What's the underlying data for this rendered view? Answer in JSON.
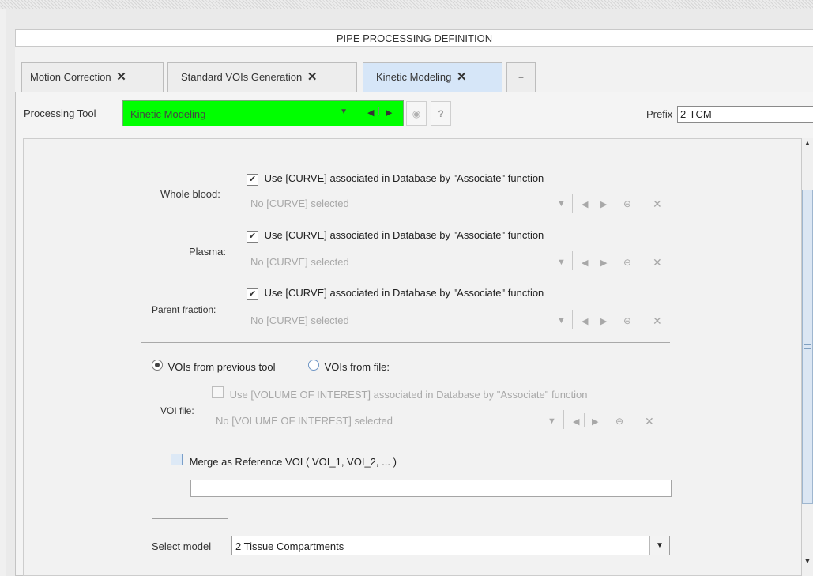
{
  "title": "PIPE PROCESSING DEFINITION",
  "tabs": [
    {
      "label": "Motion Correction",
      "close": "✕"
    },
    {
      "label": "Standard VOIs Generation",
      "close": "✕"
    },
    {
      "label": "Kinetic Modeling",
      "close": "✕"
    },
    {
      "label": "+"
    }
  ],
  "toolbar": {
    "processing_tool_label": "Processing Tool",
    "tool_value": "Kinetic Modeling",
    "help": "?",
    "prefix_label": "Prefix",
    "prefix_value": "2-TCM"
  },
  "curves": [
    {
      "label": "Whole blood:",
      "checkbox_label": "Use [CURVE] associated in Database by \"Associate\" function",
      "checked": true,
      "selector": "No [CURVE] selected"
    },
    {
      "label": "Plasma:",
      "checkbox_label": "Use [CURVE] associated in Database by \"Associate\" function",
      "checked": true,
      "selector": "No [CURVE] selected"
    },
    {
      "label": "Parent fraction:",
      "checkbox_label": "Use [CURVE] associated in Database by \"Associate\" function",
      "checked": true,
      "selector": "No [CURVE] selected"
    }
  ],
  "voi_source": {
    "option_previous": "VOIs from previous tool",
    "option_file": "VOIs from file:",
    "selected": "previous"
  },
  "voi_file": {
    "label": "VOI file:",
    "checkbox_label": "Use [VOLUME OF INTEREST] associated in Database by \"Associate\" function",
    "selector": "No [VOLUME OF INTEREST] selected"
  },
  "merge": {
    "label": "Merge as Reference VOI ( VOI_1, VOI_2, ... )",
    "checked": false,
    "text_value": ""
  },
  "model": {
    "label": "Select model",
    "value": "2 Tissue Compartments"
  },
  "colors": {
    "tool_bg": "#00ff00",
    "active_tab": "#d6e6f8"
  }
}
